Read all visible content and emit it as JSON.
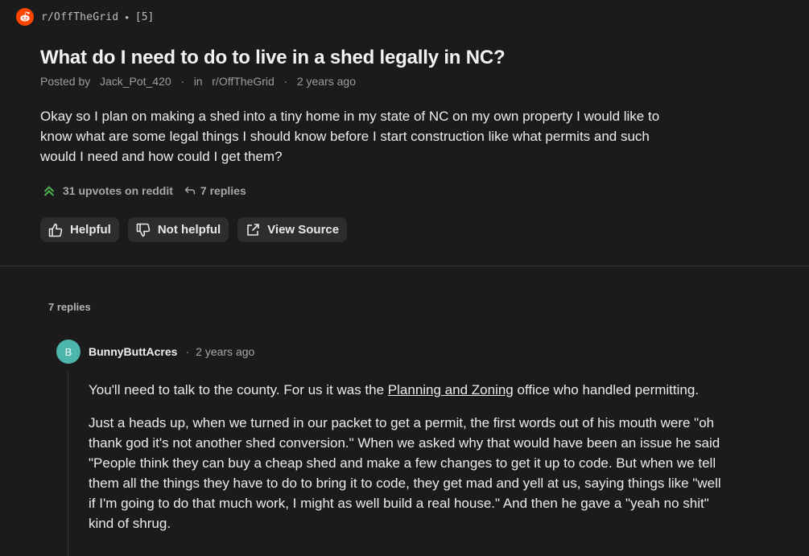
{
  "header": {
    "subreddit": "r/OffTheGrid",
    "separator": "•",
    "reply_count": "[5]"
  },
  "post": {
    "title": "What do I need to do to live in a shed legally in NC?",
    "posted_by_label": "Posted by",
    "author": "Jack_Pot_420",
    "sep1": "·",
    "in_label": "in",
    "subreddit": "r/OffTheGrid",
    "sep2": "·",
    "time": "2 years ago",
    "body": "Okay so I plan on making a shed into a tiny home in my state of NC on my own property I would like to know what are some legal things I should know before I start construction like what permits and such would I need and how could I get them?",
    "upvotes": "31 upvotes on reddit",
    "replies": "7 replies"
  },
  "actions": {
    "helpful": "Helpful",
    "not_helpful": "Not helpful",
    "view_source": "View Source"
  },
  "replies_section": {
    "heading": "7 replies"
  },
  "comment": {
    "avatar_letter": "B",
    "avatar_color": "#4db6ac",
    "author": "BunnyButtAcres",
    "dot": "·",
    "time": "2 years ago",
    "p1_before": "You'll need to talk to the county. For us it was the ",
    "p1_link": "Planning and Zoning",
    "p1_after": " office who handled permitting.",
    "p2": "Just a heads up, when we turned in our packet to get a permit, the first words out of his mouth were \"oh thank god it's not another shed conversion.\" When we asked why that would have been an issue he said \"People think they can buy a cheap shed and make a few changes to get it up to code. But when we tell them all the things they have to do to bring it to code, they get mad and yell at us, saying things like \"well if I'm going to do that much work, I might as well build a real house.\" And then he gave a \"yeah no shit\" kind of shrug."
  },
  "colors": {
    "background": "#1b1b1b",
    "reddit_orange": "#ff4500",
    "upvote_green": "#4caf50",
    "button_bg": "#2d2d2d"
  },
  "icons": [
    "reddit-logo-icon",
    "upvote-icon",
    "reply-icon",
    "thumbs-up-icon",
    "thumbs-down-icon",
    "external-link-icon"
  ]
}
